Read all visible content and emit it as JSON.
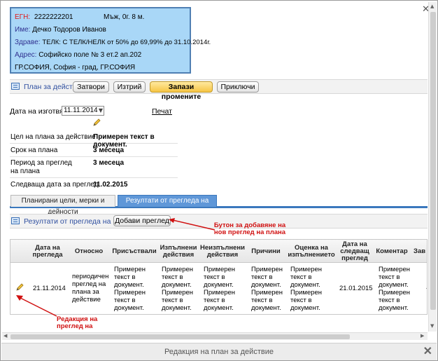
{
  "patient": {
    "egn_label": "ЕГН:",
    "egn_value": "2222222201",
    "gender_age": "Мъж, 0г. 8 м.",
    "name_label": "Име:",
    "name_value": "Дечко Тодоров Иванов",
    "health_label": "Здраве:",
    "health_value": "ТЕЛК: С ТЕЛК/НЕЛК от 50% до 69,99% до 31.10.2014г.",
    "address_label": "Адрес:",
    "address_value": "Софийско поле № 3 ет.2 ап.202",
    "city_line": "ГР.СОФИЯ, София - град, ГР.СОФИЯ"
  },
  "action_bar": {
    "title": "План за действие",
    "buttons": [
      "Затвори",
      "Изтрий",
      "Запази промените",
      "Приключи"
    ]
  },
  "form": {
    "date_label": "Дата на изготвяне",
    "date_value": "11.11.2014",
    "print_link": "Печат"
  },
  "info": [
    {
      "label": "Цел на плана за действие",
      "value": "Примерен текст в документ."
    },
    {
      "label": "Срок на плана",
      "value": "3 месеца"
    },
    {
      "label": "Период за преглед на плана",
      "value": "3 месеца"
    },
    {
      "label": "Следваща дата за преглед",
      "value": "11.02.2015"
    }
  ],
  "tabs": [
    "Планирани цели, мерки и дейности",
    "Резултати от прегледа на плана"
  ],
  "sub_bar": {
    "title": "Резултати от прегледа на плана",
    "add_button": "Добави преглед"
  },
  "annotations": {
    "add_button_note": "Бутон за добавяне на нов преглед на плана",
    "edit_note": "Редакция на преглед на плана"
  },
  "table": {
    "headers": [
      "Дата на прегледа",
      "Относно",
      "Присъствали",
      "Изпълнени действия",
      "Неизпълнени действия",
      "Причини",
      "Оценка на изпълнението",
      "Дата на следващ преглед",
      "Коментар",
      "Зав"
    ],
    "row": {
      "date": "21.11.2014",
      "about": "периодичен преглед на плана за действие",
      "present": "Примерен текст в документ. Примерен текст в документ.",
      "done": "Примерен текст в документ. Примерен текст в документ.",
      "not_done": "Примерен текст в документ. Примерен текст в документ.",
      "reasons": "Примерен текст в документ. Примерен текст в документ.",
      "assessment": "Примерен текст в документ. Примерен текст в документ.",
      "next_date": "21.01.2015",
      "comment": "Примерен текст в документ. Примерен текст в документ.",
      "last": "-"
    }
  },
  "footer": {
    "title": "Редакция на план за действие"
  },
  "colors": {
    "patient_bg": "#a9d7f7",
    "accent": "#3b78bd",
    "annotation": "#d01010",
    "primary_button": "#f6c544"
  }
}
